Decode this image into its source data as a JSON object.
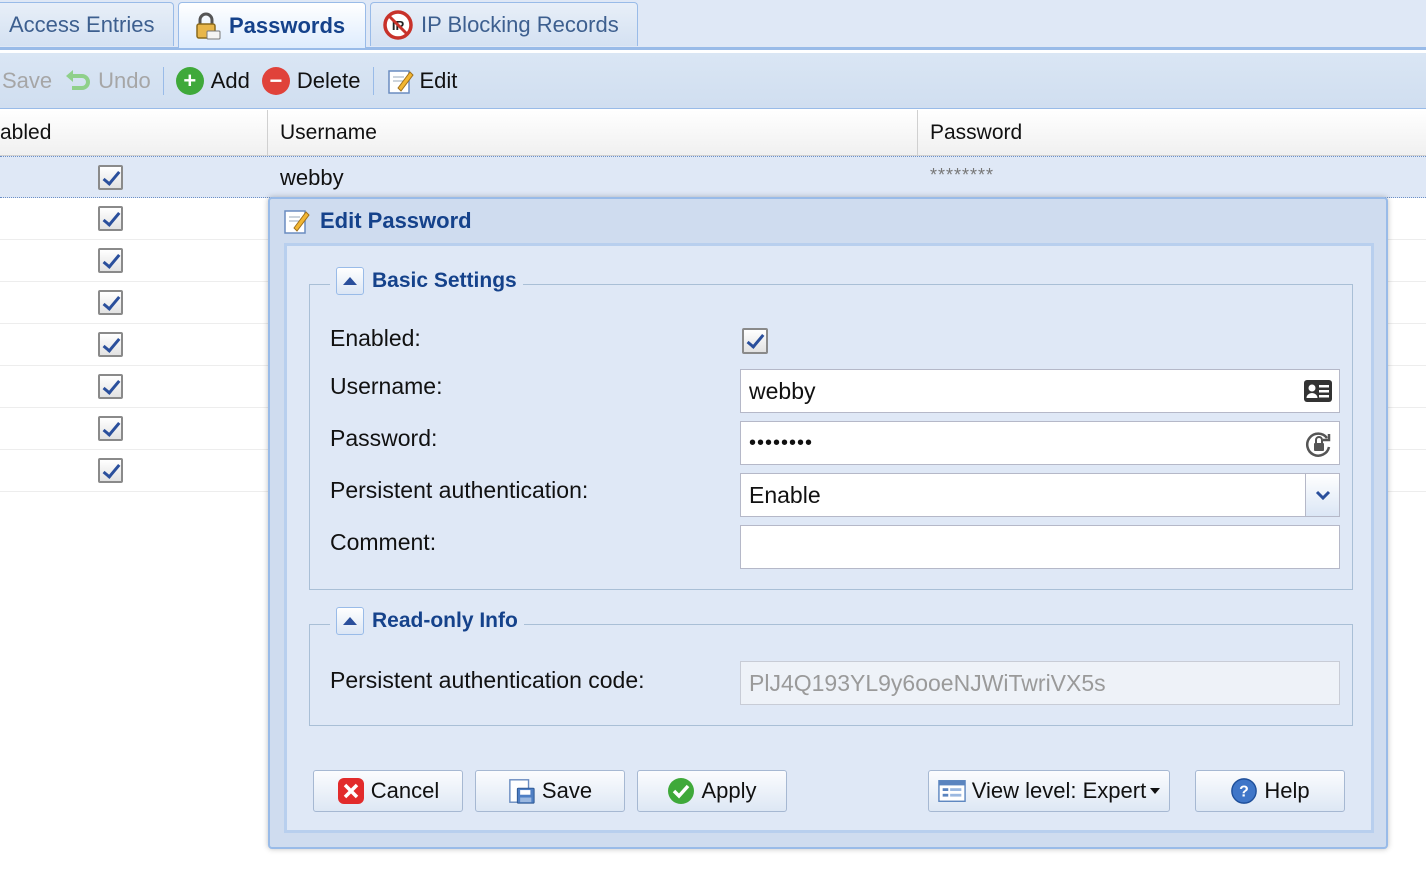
{
  "tabs": [
    {
      "label": "Access Entries",
      "icon": "none"
    },
    {
      "label": "Passwords",
      "icon": "lock-icon"
    },
    {
      "label": "IP Blocking Records",
      "icon": "ip-blocked-icon"
    }
  ],
  "toolbar": {
    "save_label": "Save",
    "undo_label": "Undo",
    "add_label": "Add",
    "delete_label": "Delete",
    "edit_label": "Edit"
  },
  "grid": {
    "columns": [
      "abled",
      "Username",
      "Password"
    ],
    "rows": [
      {
        "enabled": true,
        "username": "webby",
        "password": "********"
      },
      {
        "enabled": true,
        "username": "",
        "password": ""
      },
      {
        "enabled": true,
        "username": "",
        "password": ""
      },
      {
        "enabled": true,
        "username": "",
        "password": ""
      },
      {
        "enabled": true,
        "username": "",
        "password": ""
      },
      {
        "enabled": true,
        "username": "",
        "password": ""
      },
      {
        "enabled": true,
        "username": "",
        "password": ""
      },
      {
        "enabled": true,
        "username": "",
        "password": ""
      }
    ]
  },
  "dialog": {
    "title": "Edit Password",
    "basic": {
      "legend": "Basic Settings",
      "enabled_label": "Enabled:",
      "enabled_value": true,
      "username_label": "Username:",
      "username_value": "webby",
      "password_label": "Password:",
      "password_value": "••••••••",
      "persistent_label": "Persistent authentication:",
      "persistent_value": "Enable",
      "comment_label": "Comment:",
      "comment_value": ""
    },
    "readonly": {
      "legend": "Read-only Info",
      "code_label": "Persistent authentication code:",
      "code_value": "PlJ4Q193YL9y6ooeNJWiTwriVX5s"
    },
    "buttons": {
      "cancel": "Cancel",
      "save": "Save",
      "apply": "Apply",
      "view_level": "View level: Expert",
      "help": "Help"
    }
  },
  "colors": {
    "accent": "#15428b",
    "border": "#99bbe8",
    "panel": "#dfe8f6",
    "add_green": "#3fa93a",
    "delete_red": "#e0423a"
  }
}
